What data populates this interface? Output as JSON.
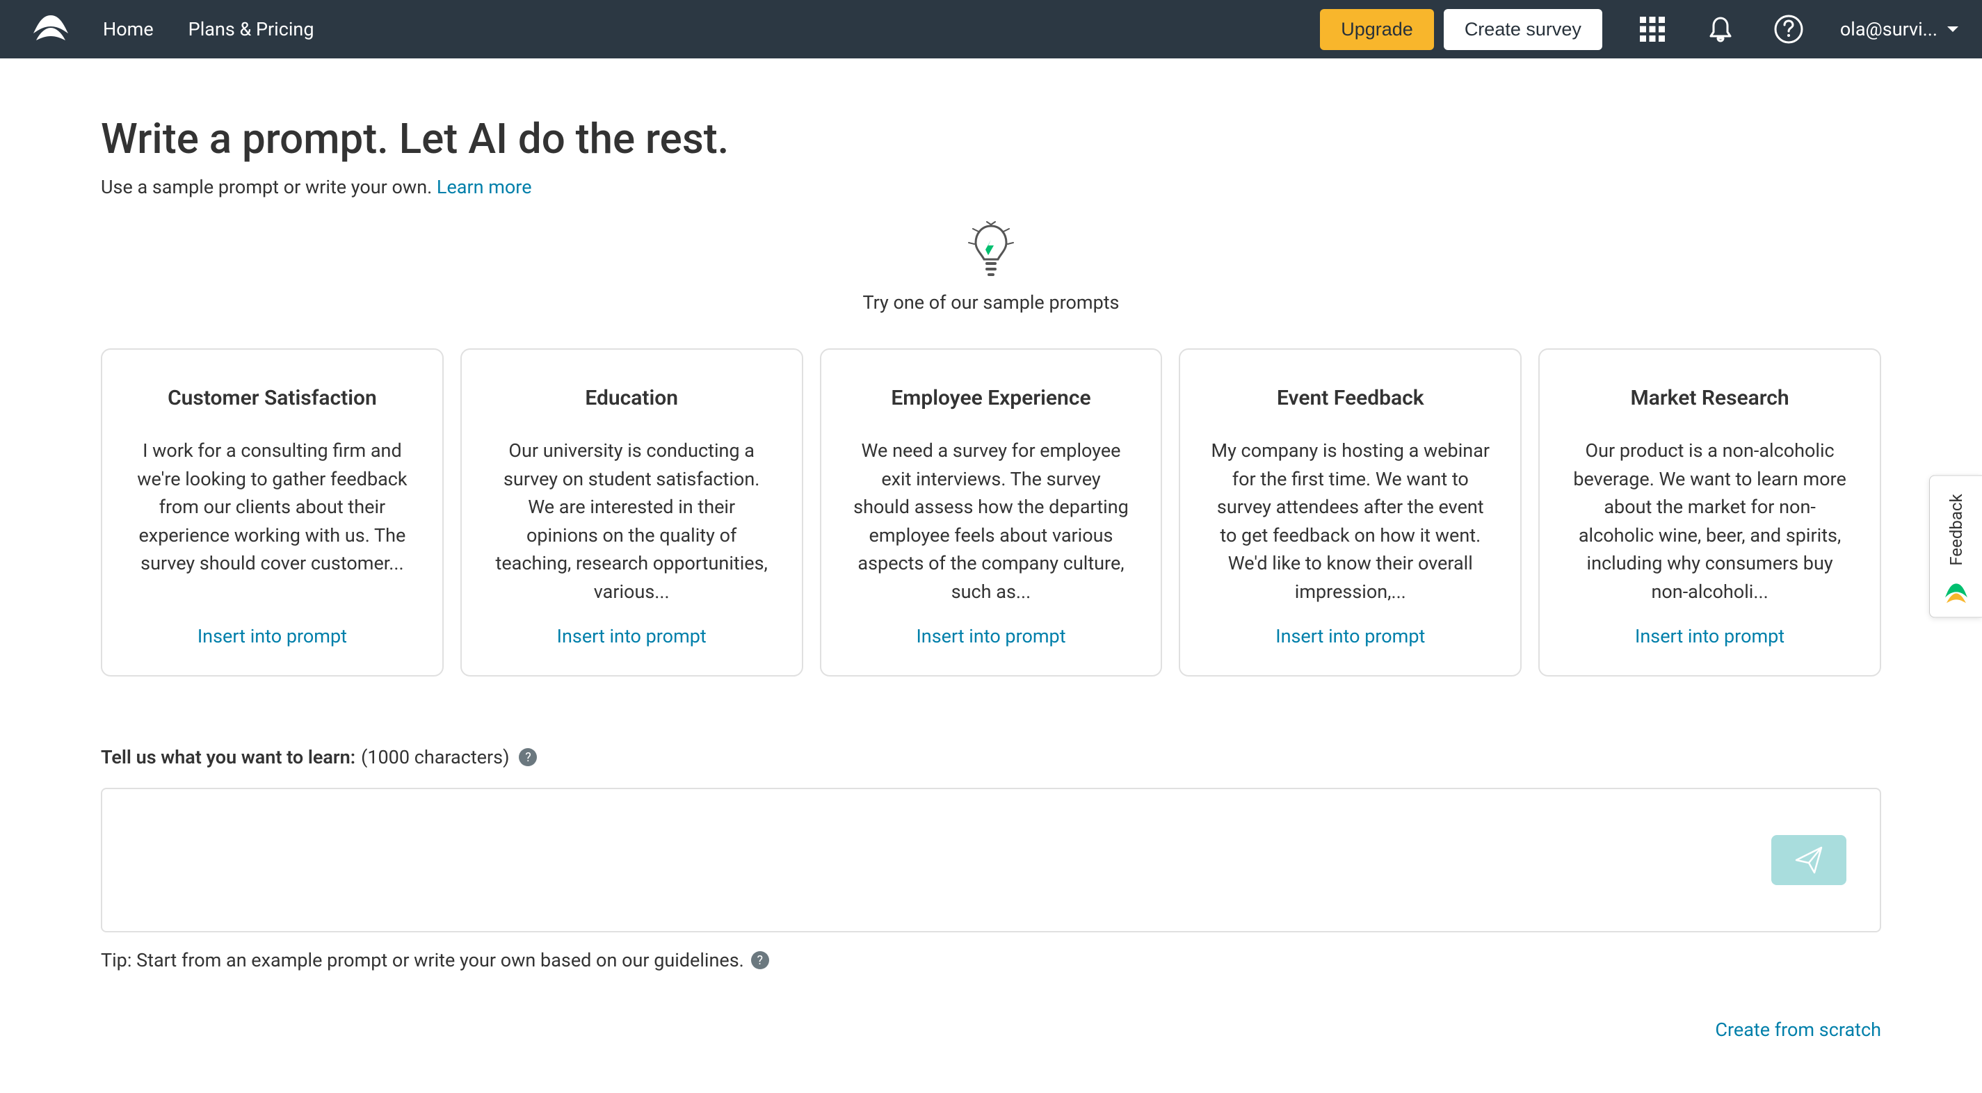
{
  "header": {
    "nav_home": "Home",
    "nav_plans": "Plans & Pricing",
    "btn_upgrade": "Upgrade",
    "btn_create": "Create survey",
    "user_label": "ola@survi..."
  },
  "page": {
    "title": "Write a prompt. Let AI do the rest.",
    "subtitle_prefix": "Use a sample prompt or write your own. ",
    "subtitle_link": "Learn more",
    "try_label": "Try one of our sample prompts"
  },
  "cards": [
    {
      "title": "Customer Satisfaction",
      "desc": "I work for a consulting firm and we're looking to gather feedback from our clients about their experience working with us. The survey should cover customer...",
      "action": "Insert into prompt"
    },
    {
      "title": "Education",
      "desc": "Our university is conducting a survey on student satisfaction. We are interested in their opinions on the quality of teaching, research opportunities, various...",
      "action": "Insert into prompt"
    },
    {
      "title": "Employee Experience",
      "desc": "We need a survey for employee exit interviews. The survey should assess how the departing employee feels about various aspects of the company culture, such as...",
      "action": "Insert into prompt"
    },
    {
      "title": "Event Feedback",
      "desc": "My company is hosting a webinar for the first time. We want to survey attendees after the event to get feedback on how it went. We'd like to know their overall impression,...",
      "action": "Insert into prompt"
    },
    {
      "title": "Market Research",
      "desc": "Our product is a non-alcoholic beverage. We want to learn more about the market for non-alcoholic wine, beer, and spirits, including why consumers buy non-alcoholi...",
      "action": "Insert into prompt"
    }
  ],
  "prompt": {
    "label_bold": "Tell us what you want to learn:",
    "label_count": "(1000 characters)",
    "tip": "Tip: Start from an example prompt or write your own based on our guidelines."
  },
  "scratch_link": "Create from scratch",
  "feedback_tab": "Feedback"
}
